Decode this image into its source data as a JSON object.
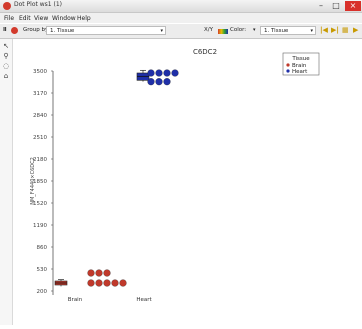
{
  "window": {
    "title": "Dot Plot ws1 (1)"
  },
  "menu": {
    "items": [
      "File",
      "Edit",
      "View",
      "Window",
      "Help"
    ]
  },
  "toolbar": {
    "group_by_label": "Group by:",
    "group_by_value": "1. Tissue",
    "xy_label": "X/Y",
    "color_label": "Color:",
    "color_value": "1. Tissue"
  },
  "colors": {
    "brain": "#c0392b",
    "heart": "#1f2fa8",
    "accent_red": "#d23a2c"
  },
  "chart_data": {
    "type": "scatter",
    "title": "C6DC2",
    "ylabel": "NM_F4440×C6DC2",
    "xlabel": "",
    "categories": [
      "Brain",
      "Heart"
    ],
    "y_ticks": [
      "3500",
      "3170",
      "2840",
      "2510",
      "2180",
      "1850",
      "1520",
      "1190",
      "860",
      "530",
      "200"
    ],
    "ylim": [
      200,
      3500
    ],
    "legend": {
      "title": "Tissue",
      "position": "top-right",
      "entries": [
        "Brain",
        "Heart"
      ]
    },
    "series": [
      {
        "name": "Brain",
        "color": "#c0392b",
        "box": {
          "median": 320,
          "q1": 290,
          "q3": 350,
          "low": 270,
          "high": 370
        },
        "points": [
          {
            "x": 1,
            "y": 470
          },
          {
            "x": 2,
            "y": 470
          },
          {
            "x": 3,
            "y": 470
          },
          {
            "x": 1,
            "y": 320
          },
          {
            "x": 2,
            "y": 320
          },
          {
            "x": 3,
            "y": 320
          },
          {
            "x": 4,
            "y": 320
          },
          {
            "x": 5,
            "y": 320
          }
        ]
      },
      {
        "name": "Heart",
        "color": "#1f2fa8",
        "box": {
          "median": 3420,
          "q1": 3360,
          "q3": 3470,
          "low": 3340,
          "high": 3510
        },
        "points": [
          {
            "x": 1,
            "y": 3470
          },
          {
            "x": 2,
            "y": 3470
          },
          {
            "x": 3,
            "y": 3470
          },
          {
            "x": 4,
            "y": 3470
          },
          {
            "x": 1,
            "y": 3340
          },
          {
            "x": 2,
            "y": 3340
          },
          {
            "x": 3,
            "y": 3340
          }
        ]
      }
    ]
  }
}
